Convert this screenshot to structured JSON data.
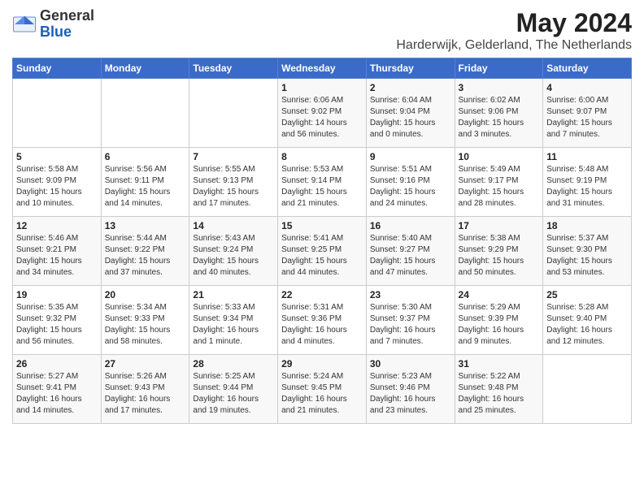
{
  "logo": {
    "general": "General",
    "blue": "Blue"
  },
  "title": "May 2024",
  "subtitle": "Harderwijk, Gelderland, The Netherlands",
  "headers": [
    "Sunday",
    "Monday",
    "Tuesday",
    "Wednesday",
    "Thursday",
    "Friday",
    "Saturday"
  ],
  "weeks": [
    [
      {
        "day": "",
        "info": ""
      },
      {
        "day": "",
        "info": ""
      },
      {
        "day": "",
        "info": ""
      },
      {
        "day": "1",
        "info": "Sunrise: 6:06 AM\nSunset: 9:02 PM\nDaylight: 14 hours\nand 56 minutes."
      },
      {
        "day": "2",
        "info": "Sunrise: 6:04 AM\nSunset: 9:04 PM\nDaylight: 15 hours\nand 0 minutes."
      },
      {
        "day": "3",
        "info": "Sunrise: 6:02 AM\nSunset: 9:06 PM\nDaylight: 15 hours\nand 3 minutes."
      },
      {
        "day": "4",
        "info": "Sunrise: 6:00 AM\nSunset: 9:07 PM\nDaylight: 15 hours\nand 7 minutes."
      }
    ],
    [
      {
        "day": "5",
        "info": "Sunrise: 5:58 AM\nSunset: 9:09 PM\nDaylight: 15 hours\nand 10 minutes."
      },
      {
        "day": "6",
        "info": "Sunrise: 5:56 AM\nSunset: 9:11 PM\nDaylight: 15 hours\nand 14 minutes."
      },
      {
        "day": "7",
        "info": "Sunrise: 5:55 AM\nSunset: 9:13 PM\nDaylight: 15 hours\nand 17 minutes."
      },
      {
        "day": "8",
        "info": "Sunrise: 5:53 AM\nSunset: 9:14 PM\nDaylight: 15 hours\nand 21 minutes."
      },
      {
        "day": "9",
        "info": "Sunrise: 5:51 AM\nSunset: 9:16 PM\nDaylight: 15 hours\nand 24 minutes."
      },
      {
        "day": "10",
        "info": "Sunrise: 5:49 AM\nSunset: 9:17 PM\nDaylight: 15 hours\nand 28 minutes."
      },
      {
        "day": "11",
        "info": "Sunrise: 5:48 AM\nSunset: 9:19 PM\nDaylight: 15 hours\nand 31 minutes."
      }
    ],
    [
      {
        "day": "12",
        "info": "Sunrise: 5:46 AM\nSunset: 9:21 PM\nDaylight: 15 hours\nand 34 minutes."
      },
      {
        "day": "13",
        "info": "Sunrise: 5:44 AM\nSunset: 9:22 PM\nDaylight: 15 hours\nand 37 minutes."
      },
      {
        "day": "14",
        "info": "Sunrise: 5:43 AM\nSunset: 9:24 PM\nDaylight: 15 hours\nand 40 minutes."
      },
      {
        "day": "15",
        "info": "Sunrise: 5:41 AM\nSunset: 9:25 PM\nDaylight: 15 hours\nand 44 minutes."
      },
      {
        "day": "16",
        "info": "Sunrise: 5:40 AM\nSunset: 9:27 PM\nDaylight: 15 hours\nand 47 minutes."
      },
      {
        "day": "17",
        "info": "Sunrise: 5:38 AM\nSunset: 9:29 PM\nDaylight: 15 hours\nand 50 minutes."
      },
      {
        "day": "18",
        "info": "Sunrise: 5:37 AM\nSunset: 9:30 PM\nDaylight: 15 hours\nand 53 minutes."
      }
    ],
    [
      {
        "day": "19",
        "info": "Sunrise: 5:35 AM\nSunset: 9:32 PM\nDaylight: 15 hours\nand 56 minutes."
      },
      {
        "day": "20",
        "info": "Sunrise: 5:34 AM\nSunset: 9:33 PM\nDaylight: 15 hours\nand 58 minutes."
      },
      {
        "day": "21",
        "info": "Sunrise: 5:33 AM\nSunset: 9:34 PM\nDaylight: 16 hours\nand 1 minute."
      },
      {
        "day": "22",
        "info": "Sunrise: 5:31 AM\nSunset: 9:36 PM\nDaylight: 16 hours\nand 4 minutes."
      },
      {
        "day": "23",
        "info": "Sunrise: 5:30 AM\nSunset: 9:37 PM\nDaylight: 16 hours\nand 7 minutes."
      },
      {
        "day": "24",
        "info": "Sunrise: 5:29 AM\nSunset: 9:39 PM\nDaylight: 16 hours\nand 9 minutes."
      },
      {
        "day": "25",
        "info": "Sunrise: 5:28 AM\nSunset: 9:40 PM\nDaylight: 16 hours\nand 12 minutes."
      }
    ],
    [
      {
        "day": "26",
        "info": "Sunrise: 5:27 AM\nSunset: 9:41 PM\nDaylight: 16 hours\nand 14 minutes."
      },
      {
        "day": "27",
        "info": "Sunrise: 5:26 AM\nSunset: 9:43 PM\nDaylight: 16 hours\nand 17 minutes."
      },
      {
        "day": "28",
        "info": "Sunrise: 5:25 AM\nSunset: 9:44 PM\nDaylight: 16 hours\nand 19 minutes."
      },
      {
        "day": "29",
        "info": "Sunrise: 5:24 AM\nSunset: 9:45 PM\nDaylight: 16 hours\nand 21 minutes."
      },
      {
        "day": "30",
        "info": "Sunrise: 5:23 AM\nSunset: 9:46 PM\nDaylight: 16 hours\nand 23 minutes."
      },
      {
        "day": "31",
        "info": "Sunrise: 5:22 AM\nSunset: 9:48 PM\nDaylight: 16 hours\nand 25 minutes."
      },
      {
        "day": "",
        "info": ""
      }
    ]
  ]
}
